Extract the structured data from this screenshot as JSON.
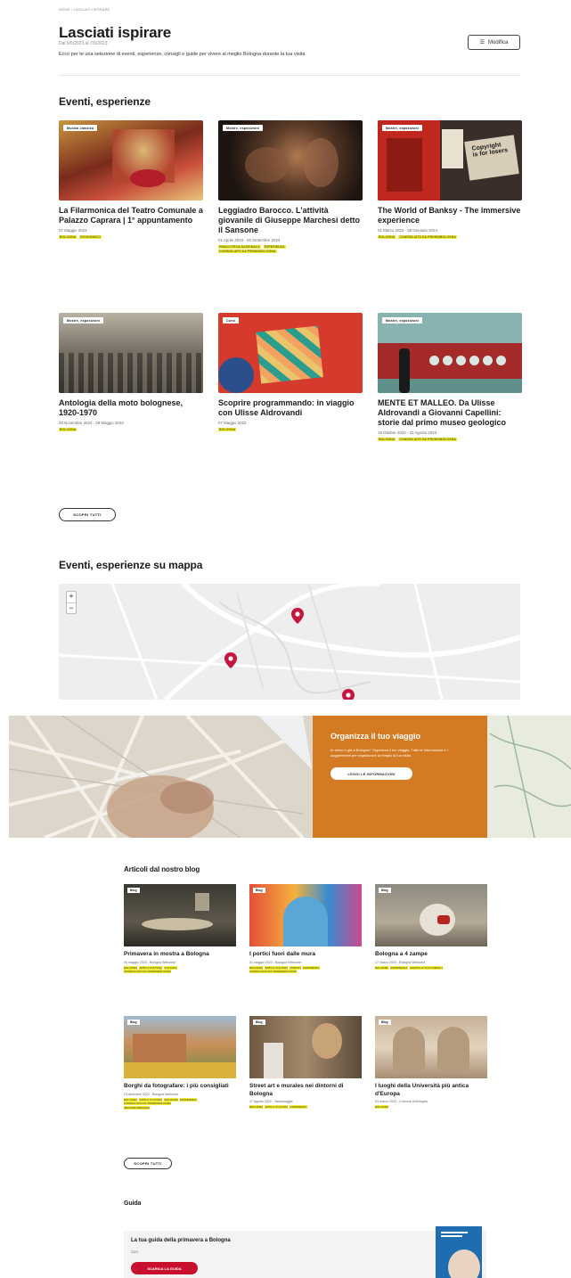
{
  "header": {
    "breadcrumb": "Home / Lasciati ispirare",
    "title": "Lasciati ispirare",
    "date_range": "Dal 6/5/2023 al 7/5/2023",
    "intro": "Ecco per te una selezione di eventi, esperienze, consigli e guide per vivere al meglio Bologna durante la tua visita",
    "filter_label": "Modifica"
  },
  "events": {
    "section_title": "Eventi, esperienze",
    "see_all": "Scopri tutti",
    "items": [
      {
        "badge": "Musica classica",
        "title": "La Filarmonica del Teatro Comunale a Palazzo Caprara | 1° appuntamento",
        "dates": "07 Maggio 2023",
        "tags": [
          "Bologna",
          "Economico"
        ]
      },
      {
        "badge": "Mostre, esposizioni",
        "title": "Leggiadro Barocco. L'attività giovanile di Giuseppe Marchesi detto il Sansone",
        "dates": "01 Aprile 2023 - 03 Settembre 2023",
        "tags": [
          "Pinacoteca nazionale",
          "Esperienza",
          "Consigliato da Promobologna"
        ]
      },
      {
        "badge": "Mostre, esposizioni",
        "title": "The World of Banksy - The immersive experience",
        "dates": "01 Marzo 2023 - 28 Gennaio 2024",
        "tags": [
          "Bologna",
          "Consigliato da Promobologna"
        ]
      },
      {
        "badge": "Mostre, esposizioni",
        "title": "Antologia della moto bolognese, 1920-1970",
        "dates": "26 Novembre 2022 - 28 Maggio 2023",
        "tags": [
          "Bologna"
        ]
      },
      {
        "badge": "Corsi",
        "title": "Scoprire programmando: in viaggio con Ulisse Aldrovandi",
        "dates": "07 Maggio 2023",
        "tags": [
          "Bologna"
        ]
      },
      {
        "badge": "Mostre, esposizioni",
        "title": "MENTE ET MALLEO. Da Ulisse Aldrovandi a Giovanni Capellini: storie dal primo museo geologico",
        "dates": "18 Ottobre 2022 - 31 Agosto 2023",
        "tags": [
          "Bologna",
          "Consigliato da Promobologna"
        ]
      }
    ]
  },
  "map_section": {
    "title": "Eventi, esperienze su mappa",
    "zoom_in": "+",
    "zoom_out": "−"
  },
  "trip": {
    "title": "Organizza il tuo viaggio",
    "description": "In arrivo o già a Bologna? Organizza il tuo viaggio. Tutte le informazioni e i suggerimenti per organizzare al meglio la tua visita.",
    "button": "Leggi le informazioni"
  },
  "blog": {
    "section_title": "Articoli dal nostro blog",
    "see_all": "Scopri tutti",
    "items": [
      {
        "badge": "Blog",
        "title": "Primavera in mostra a Bologna",
        "dates": "04 maggio 2023 - Bologna Welcome",
        "tags": [
          "Bologna",
          "Arte e cultura",
          "Cultura",
          "Consigliato da Promobologna"
        ]
      },
      {
        "badge": "Blog",
        "title": "I portici fuori dalle mura",
        "dates": "04 maggio 2023 - Bologna Welcome",
        "tags": [
          "Bologna",
          "Arte e cultura",
          "Portici",
          "Esperienza",
          "Consigliato da Promobologna"
        ]
      },
      {
        "badge": "Blog",
        "title": "Bologna a 4 zampe",
        "dates": "17 marzo 2023 - Bologna Welcome",
        "tags": [
          "Bologna",
          "Esperienza",
          "Adatto ai tuoi animali"
        ]
      },
      {
        "badge": "Blog",
        "title": "Borghi da fotografare: i più consigliati",
        "dates": "23 dicembre 2022 - Bologna Welcome",
        "tags": [
          "Bologna",
          "Arte e cultura",
          "Bologna",
          "Esperienza",
          "Consigliato da Promobologna",
          "Instagrammabile"
        ]
      },
      {
        "badge": "Blog",
        "title": "Street art e murales nei dintorni di Bologna",
        "dates": "27 agosto 2022 - Valsamoggia",
        "tags": [
          "Bologna",
          "Arte e cultura",
          "Esperienza"
        ]
      },
      {
        "badge": "Blog",
        "title": "I luoghi della Università più antica d'Europa",
        "dates": "03 marzo 2023 - Comune di Bologna",
        "tags": [
          "Bologna"
        ]
      }
    ]
  },
  "guide": {
    "section_title": "Guida",
    "title": "La tua guida della primavera a Bologna",
    "subtitle": "2023",
    "button": "Scarica la guida"
  },
  "colors": {
    "accent_red": "#c8102e",
    "tag_yellow": "#f3ee39",
    "trip_orange": "#d47a23",
    "pin_red": "#c4163f"
  }
}
